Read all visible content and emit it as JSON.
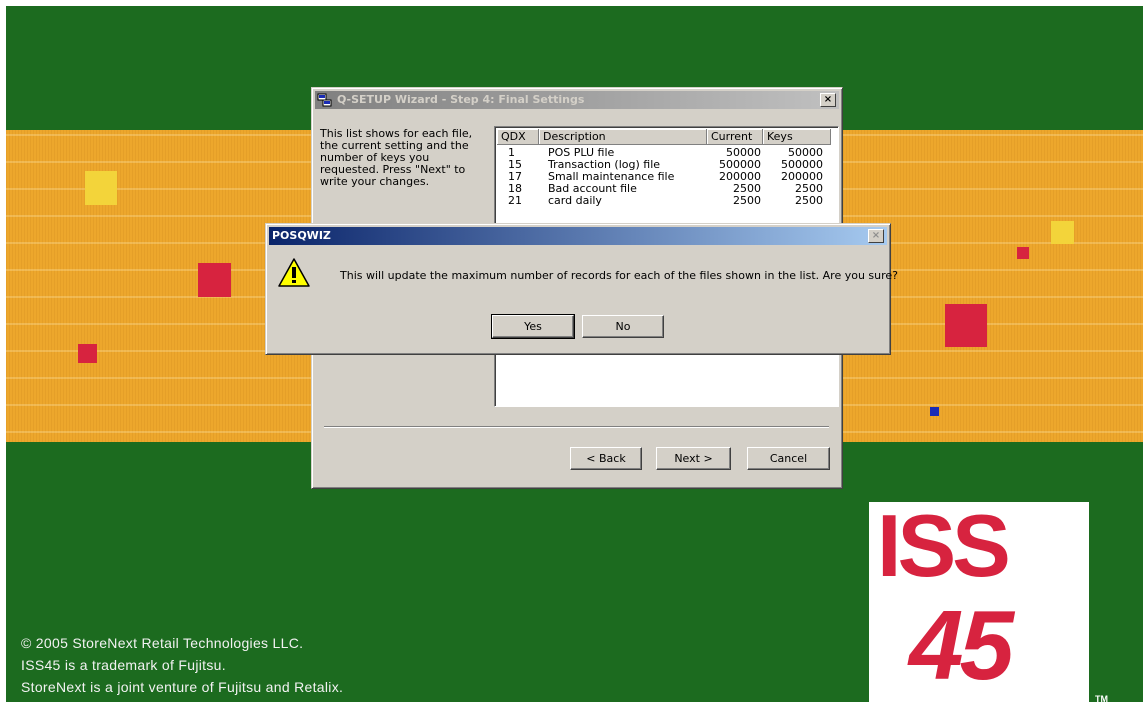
{
  "wizard": {
    "title": "Q-SETUP Wizard - Step 4: Final Settings",
    "close": "×",
    "description": "This list shows for each file, the current setting and the number of keys you requested. Press \"Next\" to write your changes.",
    "columns": [
      "QDX",
      "Description",
      "Current",
      "Keys"
    ],
    "rows": [
      {
        "qdx": "1",
        "description": "POS PLU file",
        "current": "50000",
        "keys": "50000"
      },
      {
        "qdx": "15",
        "description": "Transaction (log) file",
        "current": "500000",
        "keys": "500000"
      },
      {
        "qdx": "17",
        "description": "Small maintenance file",
        "current": "200000",
        "keys": "200000"
      },
      {
        "qdx": "18",
        "description": "Bad account file",
        "current": "2500",
        "keys": "2500"
      },
      {
        "qdx": "21",
        "description": "card daily",
        "current": "2500",
        "keys": "2500"
      }
    ],
    "back_label": "< Back",
    "next_label": "Next >",
    "cancel_label": "Cancel"
  },
  "dialog": {
    "title": "POSQWIZ",
    "close": "×",
    "icon": "warning-icon",
    "message": "This will update the maximum number of records for each of the files shown in the list. Are you sure?",
    "yes_label": "Yes",
    "no_label": "No"
  },
  "background": {
    "copyright_lines": [
      "© 2005 StoreNext Retail Technologies LLC.",
      "ISS45 is a trademark of Fujitsu.",
      "StoreNext is a joint venture of Fujitsu and Retalix."
    ],
    "logo_top": "ISS",
    "logo_bottom": "45",
    "trademark": "TM",
    "colors": {
      "green": "#1c6b1f",
      "band": "#eda72c",
      "red": "#d7233f",
      "yellow": "#f3d43a",
      "blue": "#1a2bb5"
    }
  }
}
